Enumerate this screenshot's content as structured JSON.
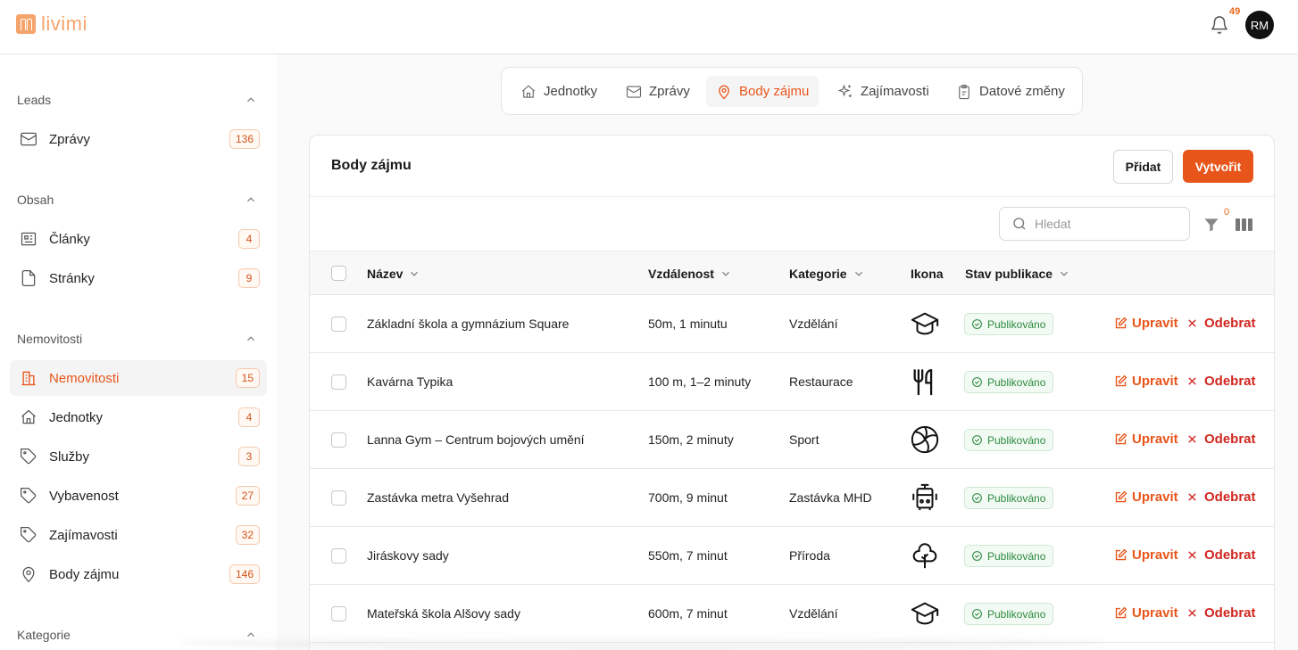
{
  "app": {
    "logo_text": "livimi",
    "notifications_count": "49",
    "user_initials": "RM"
  },
  "sidebar": {
    "sections": [
      {
        "title": "Leads",
        "items": [
          {
            "label": "Zprávy",
            "count": "136",
            "icon": "mail-icon"
          }
        ]
      },
      {
        "title": "Obsah",
        "items": [
          {
            "label": "Články",
            "count": "4",
            "icon": "newspaper-icon"
          },
          {
            "label": "Stránky",
            "count": "9",
            "icon": "file-icon"
          }
        ]
      },
      {
        "title": "Nemovitosti",
        "items": [
          {
            "label": "Nemovitosti",
            "count": "15",
            "icon": "building-icon",
            "active": true
          },
          {
            "label": "Jednotky",
            "count": "4",
            "icon": "home-icon"
          },
          {
            "label": "Služby",
            "count": "3",
            "icon": "tag-icon"
          },
          {
            "label": "Vybavenost",
            "count": "27",
            "icon": "tag-icon"
          },
          {
            "label": "Zajímavosti",
            "count": "32",
            "icon": "tag-icon"
          },
          {
            "label": "Body zájmu",
            "count": "146",
            "icon": "map-pin-icon"
          }
        ]
      },
      {
        "title": "Kategorie",
        "items": []
      }
    ]
  },
  "tabs": [
    {
      "label": "Jednotky",
      "icon": "home-icon"
    },
    {
      "label": "Zprávy",
      "icon": "mail-icon"
    },
    {
      "label": "Body zájmu",
      "icon": "map-pin-icon",
      "active": true
    },
    {
      "label": "Zajímavosti",
      "icon": "sparkles-icon"
    },
    {
      "label": "Datové změny",
      "icon": "clipboard-icon"
    }
  ],
  "card": {
    "title": "Body zájmu",
    "add_label": "Přidat",
    "create_label": "Vytvořit",
    "search_placeholder": "Hledat",
    "filter_count": "0"
  },
  "table": {
    "columns": {
      "name": "Název",
      "distance": "Vzdálenost",
      "category": "Kategorie",
      "icon": "Ikona",
      "status": "Stav publikace"
    },
    "edit_label": "Upravit",
    "remove_label": "Odebrat",
    "rows": [
      {
        "name": "Základní škola a gymnázium Square",
        "distance": "50m, 1 minutu",
        "category": "Vzdělání",
        "icon": "graduation-cap-icon",
        "status": "Publikováno"
      },
      {
        "name": "Kavárna Typika",
        "distance": "100 m, 1–2 minuty",
        "category": "Restaurace",
        "icon": "utensils-icon",
        "status": "Publikováno"
      },
      {
        "name": "Lanna Gym – Centrum bojových umění",
        "distance": "150m, 2 minuty",
        "category": "Sport",
        "icon": "volleyball-icon",
        "status": "Publikováno"
      },
      {
        "name": "Zastávka metra Vyšehrad",
        "distance": "700m, 9 minut",
        "category": "Zastávka MHD",
        "icon": "tram-icon",
        "status": "Publikováno"
      },
      {
        "name": "Jiráskovy sady",
        "distance": "550m, 7 minut",
        "category": "Příroda",
        "icon": "tree-icon",
        "status": "Publikováno"
      },
      {
        "name": "Mateřská škola Alšovy sady",
        "distance": "600m, 7 minut",
        "category": "Vzdělání",
        "icon": "graduation-cap-icon",
        "status": "Publikováno"
      }
    ]
  },
  "colors": {
    "accent": "#e8551a",
    "danger": "#d1261f",
    "success": "#2d8a3f"
  }
}
